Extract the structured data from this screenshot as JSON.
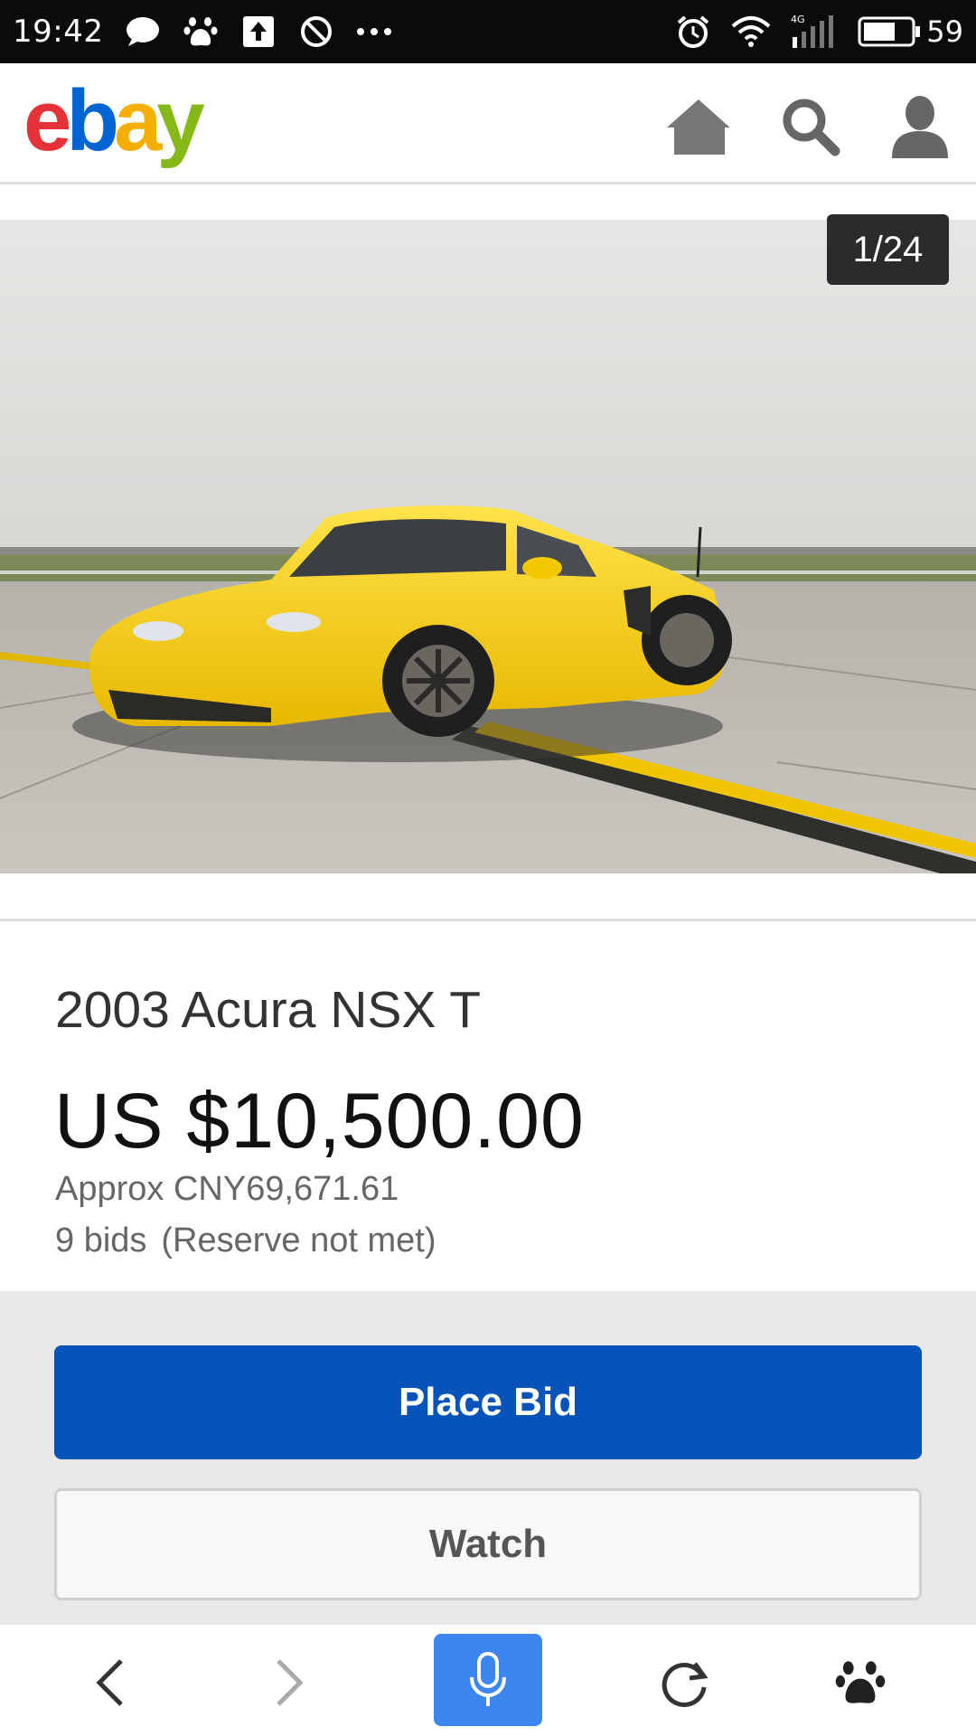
{
  "status_bar": {
    "time": "19:42",
    "battery": "59",
    "network": "4G",
    "icons_left": [
      "message-icon",
      "baidu-paw-icon",
      "upload-icon",
      "block-icon",
      "more-dots-icon"
    ],
    "icons_right": [
      "alarm-icon",
      "wifi-icon",
      "signal-icon",
      "battery-icon"
    ]
  },
  "header": {
    "logo": {
      "e": "e",
      "b": "b",
      "a": "a",
      "y": "y"
    },
    "icons": [
      "home-icon",
      "search-icon",
      "user-icon"
    ]
  },
  "gallery": {
    "counter": "1/24",
    "image_subject": "yellow sports car on runway"
  },
  "item": {
    "title": "2003 Acura NSX T",
    "price": "US $10,500.00",
    "approx": "Approx CNY69,671.61",
    "bids": "9 bids",
    "reserve": "(Reserve not met)"
  },
  "actions": {
    "place_bid": "Place Bid",
    "watch": "Watch"
  },
  "browser_bar": {
    "icons": [
      "back-icon",
      "forward-icon",
      "microphone-icon",
      "refresh-icon",
      "baidu-paw-icon"
    ]
  },
  "colors": {
    "place_bid_bg": "#0654ba",
    "mic_bg": "#3b86f0",
    "ebay_e": "#e53238",
    "ebay_b": "#0064d2",
    "ebay_a": "#f5af02",
    "ebay_y": "#86b817"
  }
}
